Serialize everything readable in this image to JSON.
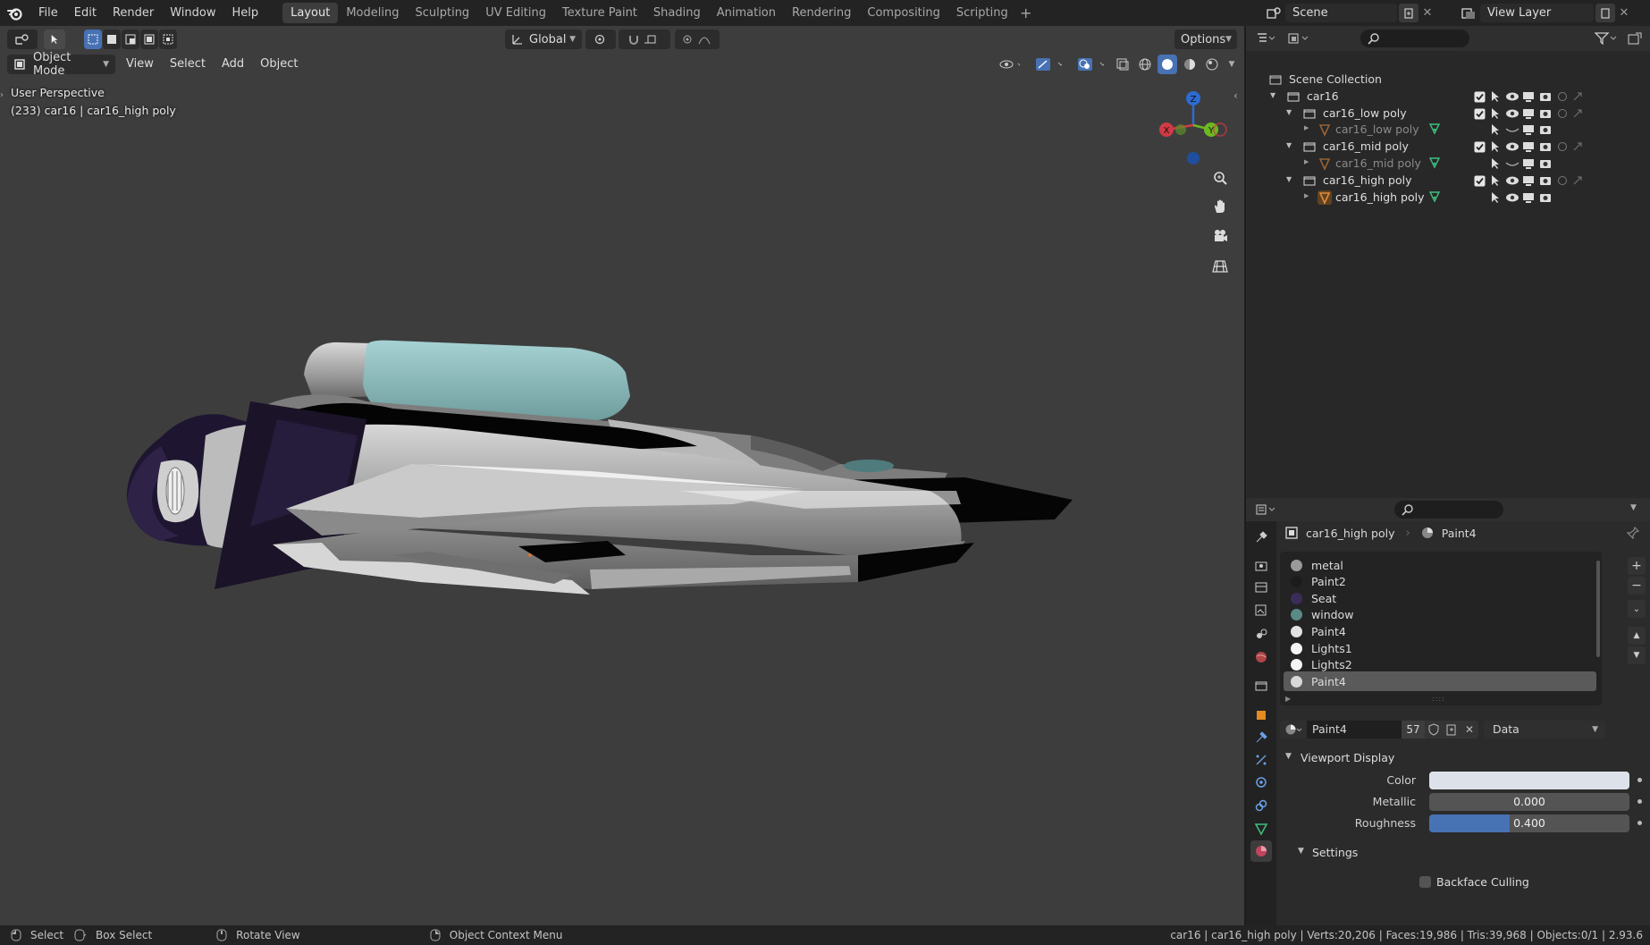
{
  "app": {
    "menus": [
      "File",
      "Edit",
      "Render",
      "Window",
      "Help"
    ]
  },
  "workspaces": [
    "Layout",
    "Modeling",
    "Sculpting",
    "UV Editing",
    "Texture Paint",
    "Shading",
    "Animation",
    "Rendering",
    "Compositing",
    "Scripting"
  ],
  "active_workspace": "Layout",
  "scene": {
    "label": "Scene",
    "view_layer": "View Layer"
  },
  "viewport": {
    "transform_orientation": "Global",
    "options_label": "Options",
    "mode": "Object Mode",
    "menus": [
      "View",
      "Select",
      "Add",
      "Object"
    ],
    "perspective_label": "User Perspective",
    "object_info": "(233) car16 | car16_high poly",
    "gizmo": {
      "x": "X",
      "y": "Y",
      "z": "Z"
    }
  },
  "outliner": {
    "root": "Scene Collection",
    "rows": [
      {
        "label": "car16",
        "kind": "collection"
      },
      {
        "label": "car16_low poly",
        "kind": "collection"
      },
      {
        "label": "car16_low poly",
        "kind": "object"
      },
      {
        "label": "car16_mid poly",
        "kind": "collection"
      },
      {
        "label": "car16_mid poly",
        "kind": "object"
      },
      {
        "label": "car16_high poly",
        "kind": "collection"
      },
      {
        "label": "car16_high poly",
        "kind": "object"
      }
    ]
  },
  "properties": {
    "object_name": "car16_high poly",
    "material_name": "Paint4",
    "slots": [
      {
        "name": "metal",
        "color": "#9a9a9a"
      },
      {
        "name": "Paint2",
        "color": "#1c1c1c"
      },
      {
        "name": "Seat",
        "color": "#3b2c5a"
      },
      {
        "name": "window",
        "color": "#5a8a86"
      },
      {
        "name": "Paint4",
        "color": "#e2e2e2"
      },
      {
        "name": "Lights1",
        "color": "#f4f4f4"
      },
      {
        "name": "Lights2",
        "color": "#f4f4f4"
      },
      {
        "name": "Paint4",
        "color": "#d8d8d8"
      }
    ],
    "selected_slot_index": 7,
    "material_field": "Paint4",
    "user_count": "57",
    "link": "Data",
    "viewport_display": {
      "header": "Viewport Display",
      "color_label": "Color",
      "metallic_label": "Metallic",
      "metallic": "0.000",
      "roughness_label": "Roughness",
      "roughness": "0.400",
      "roughness_fraction": 0.4,
      "settings_label": "Settings",
      "backface_culling": "Backface Culling"
    }
  },
  "status": {
    "select": "Select",
    "box_select": "Box Select",
    "rotate": "Rotate View",
    "context": "Object Context Menu",
    "stats": "car16 | car16_high poly | Verts:20,206 | Faces:19,986 | Tris:39,968 | Objects:0/1 | 2.93.6"
  },
  "colors": {
    "accent": "#4772b3",
    "viewport_bg": "#3d3d3d"
  }
}
